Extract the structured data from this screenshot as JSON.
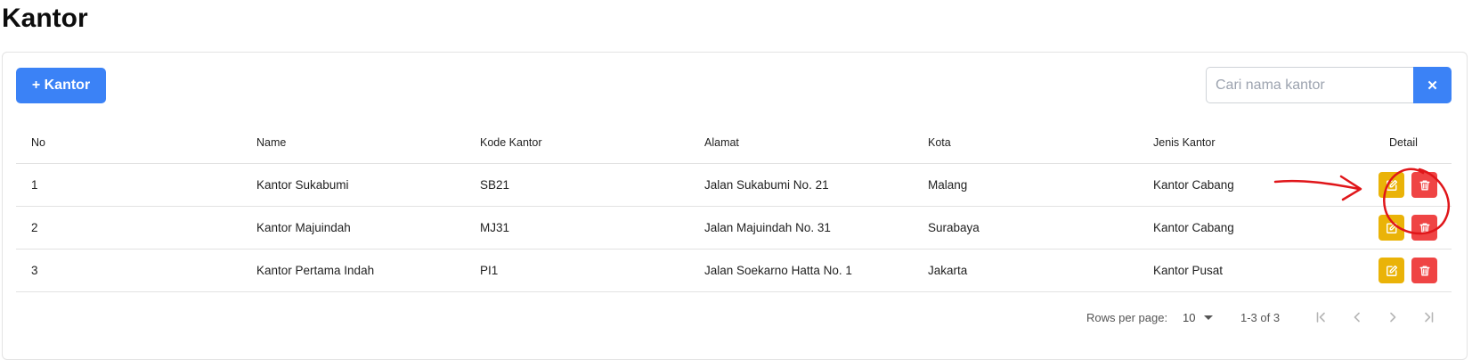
{
  "page": {
    "title": "Kantor"
  },
  "toolbar": {
    "add_label": "+ Kantor"
  },
  "search": {
    "placeholder": "Cari nama kantor",
    "value": "",
    "clear_icon": "close-icon"
  },
  "table": {
    "headers": [
      "No",
      "Name",
      "Kode Kantor",
      "Alamat",
      "Kota",
      "Jenis Kantor",
      "Detail"
    ],
    "rows": [
      {
        "no": "1",
        "name": "Kantor Sukabumi",
        "kode": "SB21",
        "alamat": "Jalan Sukabumi No. 21",
        "kota": "Malang",
        "jenis": "Kantor Cabang"
      },
      {
        "no": "2",
        "name": "Kantor Majuindah",
        "kode": "MJ31",
        "alamat": "Jalan Majuindah No. 31",
        "kota": "Surabaya",
        "jenis": "Kantor Cabang"
      },
      {
        "no": "3",
        "name": "Kantor Pertama Indah",
        "kode": "PI1",
        "alamat": "Jalan Soekarno Hatta No. 1",
        "kota": "Jakarta",
        "jenis": "Kantor Pusat"
      }
    ],
    "row_action_icons": [
      "edit-icon",
      "trash-icon"
    ]
  },
  "pagination": {
    "rows_per_page_label": "Rows per page:",
    "rows_per_page": "10",
    "range": "1-3 of 3"
  },
  "colors": {
    "primary": "#3b82f6",
    "edit": "#eab308",
    "delete": "#ef4444",
    "annotation": "#e0161a"
  }
}
